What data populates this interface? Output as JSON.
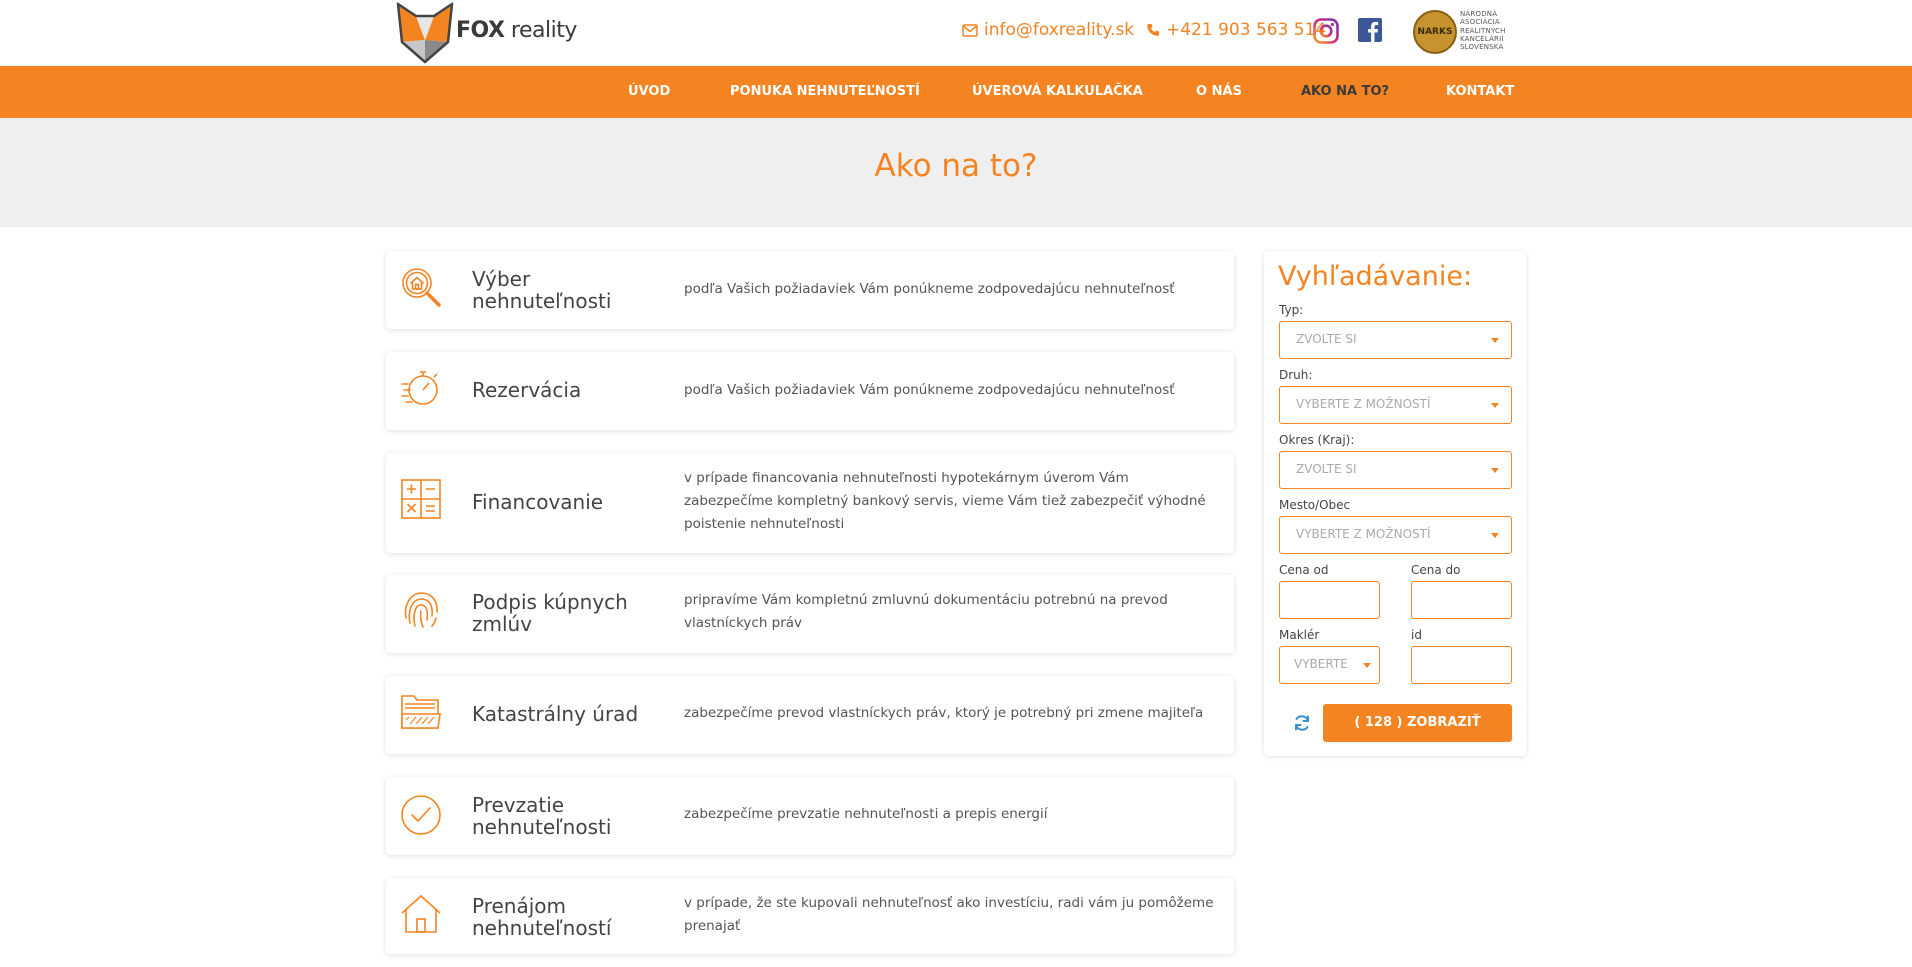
{
  "brand": {
    "name_bold": "FOX",
    "name_rest": " reality"
  },
  "contact": {
    "email": "info@foxreality.sk",
    "phone": "+421 903 563 514"
  },
  "narks": {
    "badge": "NARKS",
    "text": "Národná asociácia realitných kancelárií Slovenska"
  },
  "nav": {
    "items": [
      {
        "label": "ÚVOD"
      },
      {
        "label": "PONUKA NEHNUTEĽNOSTÍ"
      },
      {
        "label": "ÚVEROVÁ KALKULAČKA"
      },
      {
        "label": "O NÁS"
      },
      {
        "label": "AKO NA TO?"
      },
      {
        "label": "KONTAKT"
      }
    ],
    "active": "AKO NA TO?"
  },
  "hero": {
    "title": "Ako na to?"
  },
  "steps": [
    {
      "icon": "house-search-icon",
      "title": "Výber nehnuteľnosti",
      "desc": "podľa Vašich požiadaviek Vám ponúkneme zodpovedajúcu nehnuteľnosť"
    },
    {
      "icon": "stopwatch-icon",
      "title": "Rezervácia",
      "desc": "podľa Vašich požiadaviek Vám ponúkneme zodpovedajúcu nehnuteľnosť"
    },
    {
      "icon": "calculator-icon",
      "title": "Financovanie",
      "desc": "v prípade financovania nehnuteľnosti hypotekárnym úverom Vám zabezpečíme kompletný bankový servis, vieme Vám tiež zabezpečiť výhodné poistenie nehnuteľnosti"
    },
    {
      "icon": "fingerprint-icon",
      "title": "Podpis kúpnych zmlúv",
      "desc": "pripravíme Vám kompletnú zmluvnú dokumentáciu potrebnú na prevod vlastníckych práv"
    },
    {
      "icon": "folder-icon",
      "title": "Katastrálny úrad",
      "desc": "zabezpečíme prevod vlastníckych práv, ktorý je potrebný pri zmene majiteľa"
    },
    {
      "icon": "checkmark-circle-icon",
      "title": "Prevzatie nehnuteľnosti",
      "desc": "zabezpečíme prevzatie nehnuteľnosti a prepis energií"
    },
    {
      "icon": "house-icon",
      "title": "Prenájom nehnuteľností",
      "desc": "v prípade, že ste kupovali nehnuteľnosť ako investíciu, radi vám ju pomôžeme prenajať"
    }
  ],
  "search": {
    "title": "Vyhľadávanie:",
    "typ": {
      "label": "Typ:",
      "value": "ZVOLTE SI"
    },
    "druh": {
      "label": "Druh:",
      "value": "VYBERTE Z MOŽNOSTÍ"
    },
    "okres": {
      "label": "Okres (Kraj):",
      "value": "ZVOLTE SI"
    },
    "mesto": {
      "label": "Mesto/Obec",
      "value": "VYBERTE Z MOŽNOSTÍ"
    },
    "cena_od": {
      "label": "Cena od",
      "value": ""
    },
    "cena_do": {
      "label": "Cena do",
      "value": ""
    },
    "makler": {
      "label": "Maklér",
      "value": "VYBERTE"
    },
    "id": {
      "label": "id",
      "value": ""
    },
    "button": "( 128 ) ZOBRAZIŤ"
  },
  "colors": {
    "accent": "#f48421",
    "hero_bg": "#efefef",
    "text": "#444444"
  }
}
